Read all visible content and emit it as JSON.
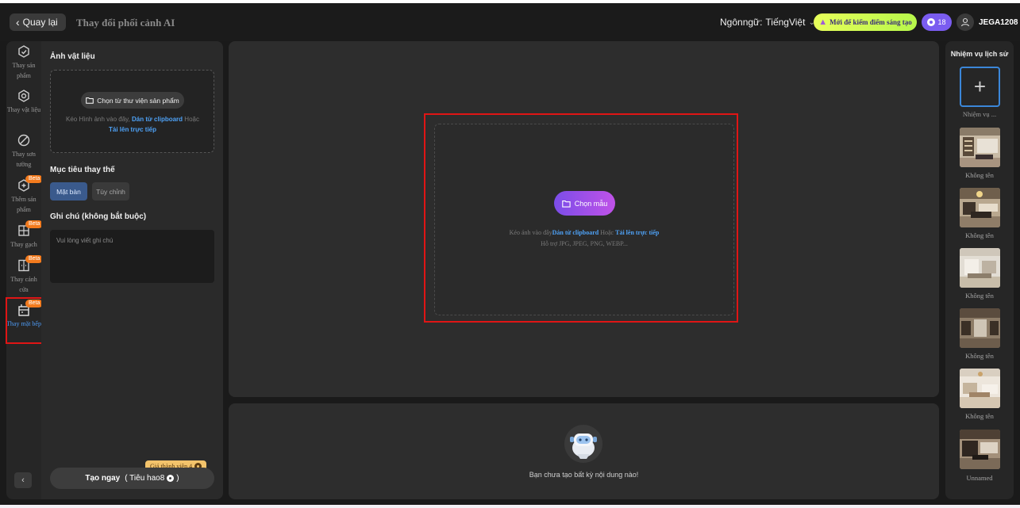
{
  "header": {
    "back_label": "Quay lại",
    "title": "Thay đổi phối cảnh AI",
    "language_label": "Ngônngữ:",
    "language_value": "TiếngViệt",
    "promo_label": "Mới để kiếm điểm sáng tạo",
    "coins": "18",
    "username": "JEGA1208"
  },
  "rail": {
    "items": [
      {
        "label": "Thay sản phẩm",
        "icon": "product-swap-icon",
        "beta": ""
      },
      {
        "label": "Thay vật liệu",
        "icon": "material-swap-icon",
        "beta": ""
      },
      {
        "label": "Thay sơn tường",
        "icon": "wall-paint-icon",
        "beta": ""
      },
      {
        "label": "Thêm sản phẩm",
        "icon": "add-product-icon",
        "beta": "Beta"
      },
      {
        "label": "Thay gạch",
        "icon": "tile-icon",
        "beta": "Beta"
      },
      {
        "label": "Thay cánh cửa",
        "icon": "door-icon",
        "beta": "Beta"
      },
      {
        "label": "Thay mặt bếp",
        "icon": "kitchen-counter-icon",
        "beta": "Beta",
        "active": true
      }
    ]
  },
  "panel": {
    "material_title": "Ảnh vật liệu",
    "library_button": "Chọn từ thư viện sản phẩm",
    "upload_hint_prefix": "Kéo Hình ảnh vào đây,",
    "paste_link": "Dán từ clipboard",
    "or_word": "Hoặc",
    "upload_link": "Tải lên trực tiếp",
    "target_title": "Mục tiêu thay thế",
    "target_options": [
      "Mặt bàn",
      "Tùy chỉnh"
    ],
    "notes_title": "Ghi chú (không bắt buộc)",
    "notes_placeholder": "Vui lòng viết ghi chú",
    "member_price": "Giá thành viên 4",
    "create_label": "Tạo ngay",
    "create_cost": "( Tiêu hao8",
    "create_cost_end": ")"
  },
  "canvas": {
    "choose_button": "Chọn mẫu",
    "drop_prefix": "Kéo ảnh vào đây",
    "paste_link": "Dán từ clipboard",
    "or_word": "Hoặc",
    "upload_link": "Tải lên trực tiếp",
    "formats": "Hỗ trợ JPG, JPEG, PNG, WEBP..."
  },
  "result": {
    "empty_text": "Bạn chưa tạo bất kỳ nội dung nào!"
  },
  "history": {
    "title": "Nhiệm vụ lịch sử",
    "new_task_label": "Nhiệm vụ ...",
    "items": [
      {
        "label": "Không tên"
      },
      {
        "label": "Không tên"
      },
      {
        "label": "Không tên"
      },
      {
        "label": "Không tên"
      },
      {
        "label": "Không tên"
      },
      {
        "label": "Unnamed"
      }
    ]
  },
  "colors": {
    "accent_blue": "#4ea1f5",
    "highlight_red": "#e01515",
    "beta_orange": "#f27a1d",
    "promo_green": "#d8fb52",
    "coin_purple": "#7a5cf0"
  }
}
